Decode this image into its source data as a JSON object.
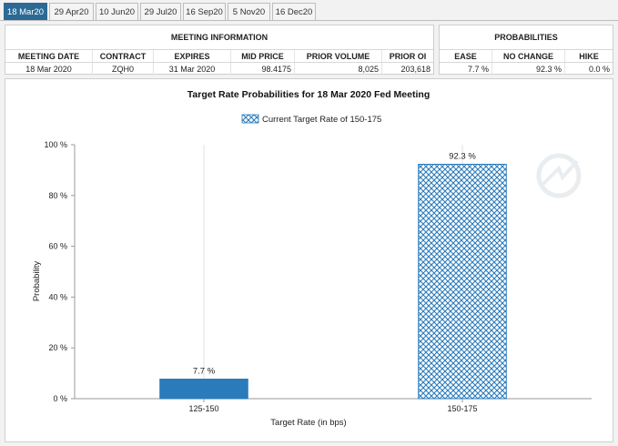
{
  "tabs": [
    {
      "label": "18 Mar20",
      "active": true
    },
    {
      "label": "29 Apr20",
      "active": false
    },
    {
      "label": "10 Jun20",
      "active": false
    },
    {
      "label": "29 Jul20",
      "active": false
    },
    {
      "label": "16 Sep20",
      "active": false
    },
    {
      "label": "5 Nov20",
      "active": false
    },
    {
      "label": "16 Dec20",
      "active": false
    }
  ],
  "meeting_info": {
    "title": "MEETING INFORMATION",
    "columns": [
      "MEETING DATE",
      "CONTRACT",
      "EXPIRES",
      "MID PRICE",
      "PRIOR VOLUME",
      "PRIOR OI"
    ],
    "values": [
      "18 Mar 2020",
      "ZQH0",
      "31 Mar 2020",
      "98.4175",
      "8,025",
      "203,618"
    ]
  },
  "probabilities": {
    "title": "PROBABILITIES",
    "columns": [
      "EASE",
      "NO CHANGE",
      "HIKE"
    ],
    "values": [
      "7.7 %",
      "92.3 %",
      "0.0 %"
    ]
  },
  "chart_data": {
    "type": "bar",
    "title": "Target Rate Probabilities for 18 Mar 2020 Fed Meeting",
    "legend": "Current Target Rate of 150-175",
    "xlabel": "Target Rate (in bps)",
    "ylabel": "Probability",
    "categories": [
      "125-150",
      "150-175"
    ],
    "values": [
      7.7,
      92.3
    ],
    "value_labels": [
      "7.7 %",
      "92.3 %"
    ],
    "ylim": [
      0,
      100
    ],
    "yticks": [
      0,
      20,
      40,
      60,
      80,
      100
    ],
    "ytick_labels": [
      "0 %",
      "20 %",
      "40 %",
      "60 %",
      "80 %",
      "100 %"
    ],
    "current_category": "150-175",
    "colors": {
      "bar": "#2b7bbb",
      "hatch_fg": "#2b7bbb",
      "hatch_bg": "#ffffff",
      "grid": "#e0e0e0"
    }
  }
}
